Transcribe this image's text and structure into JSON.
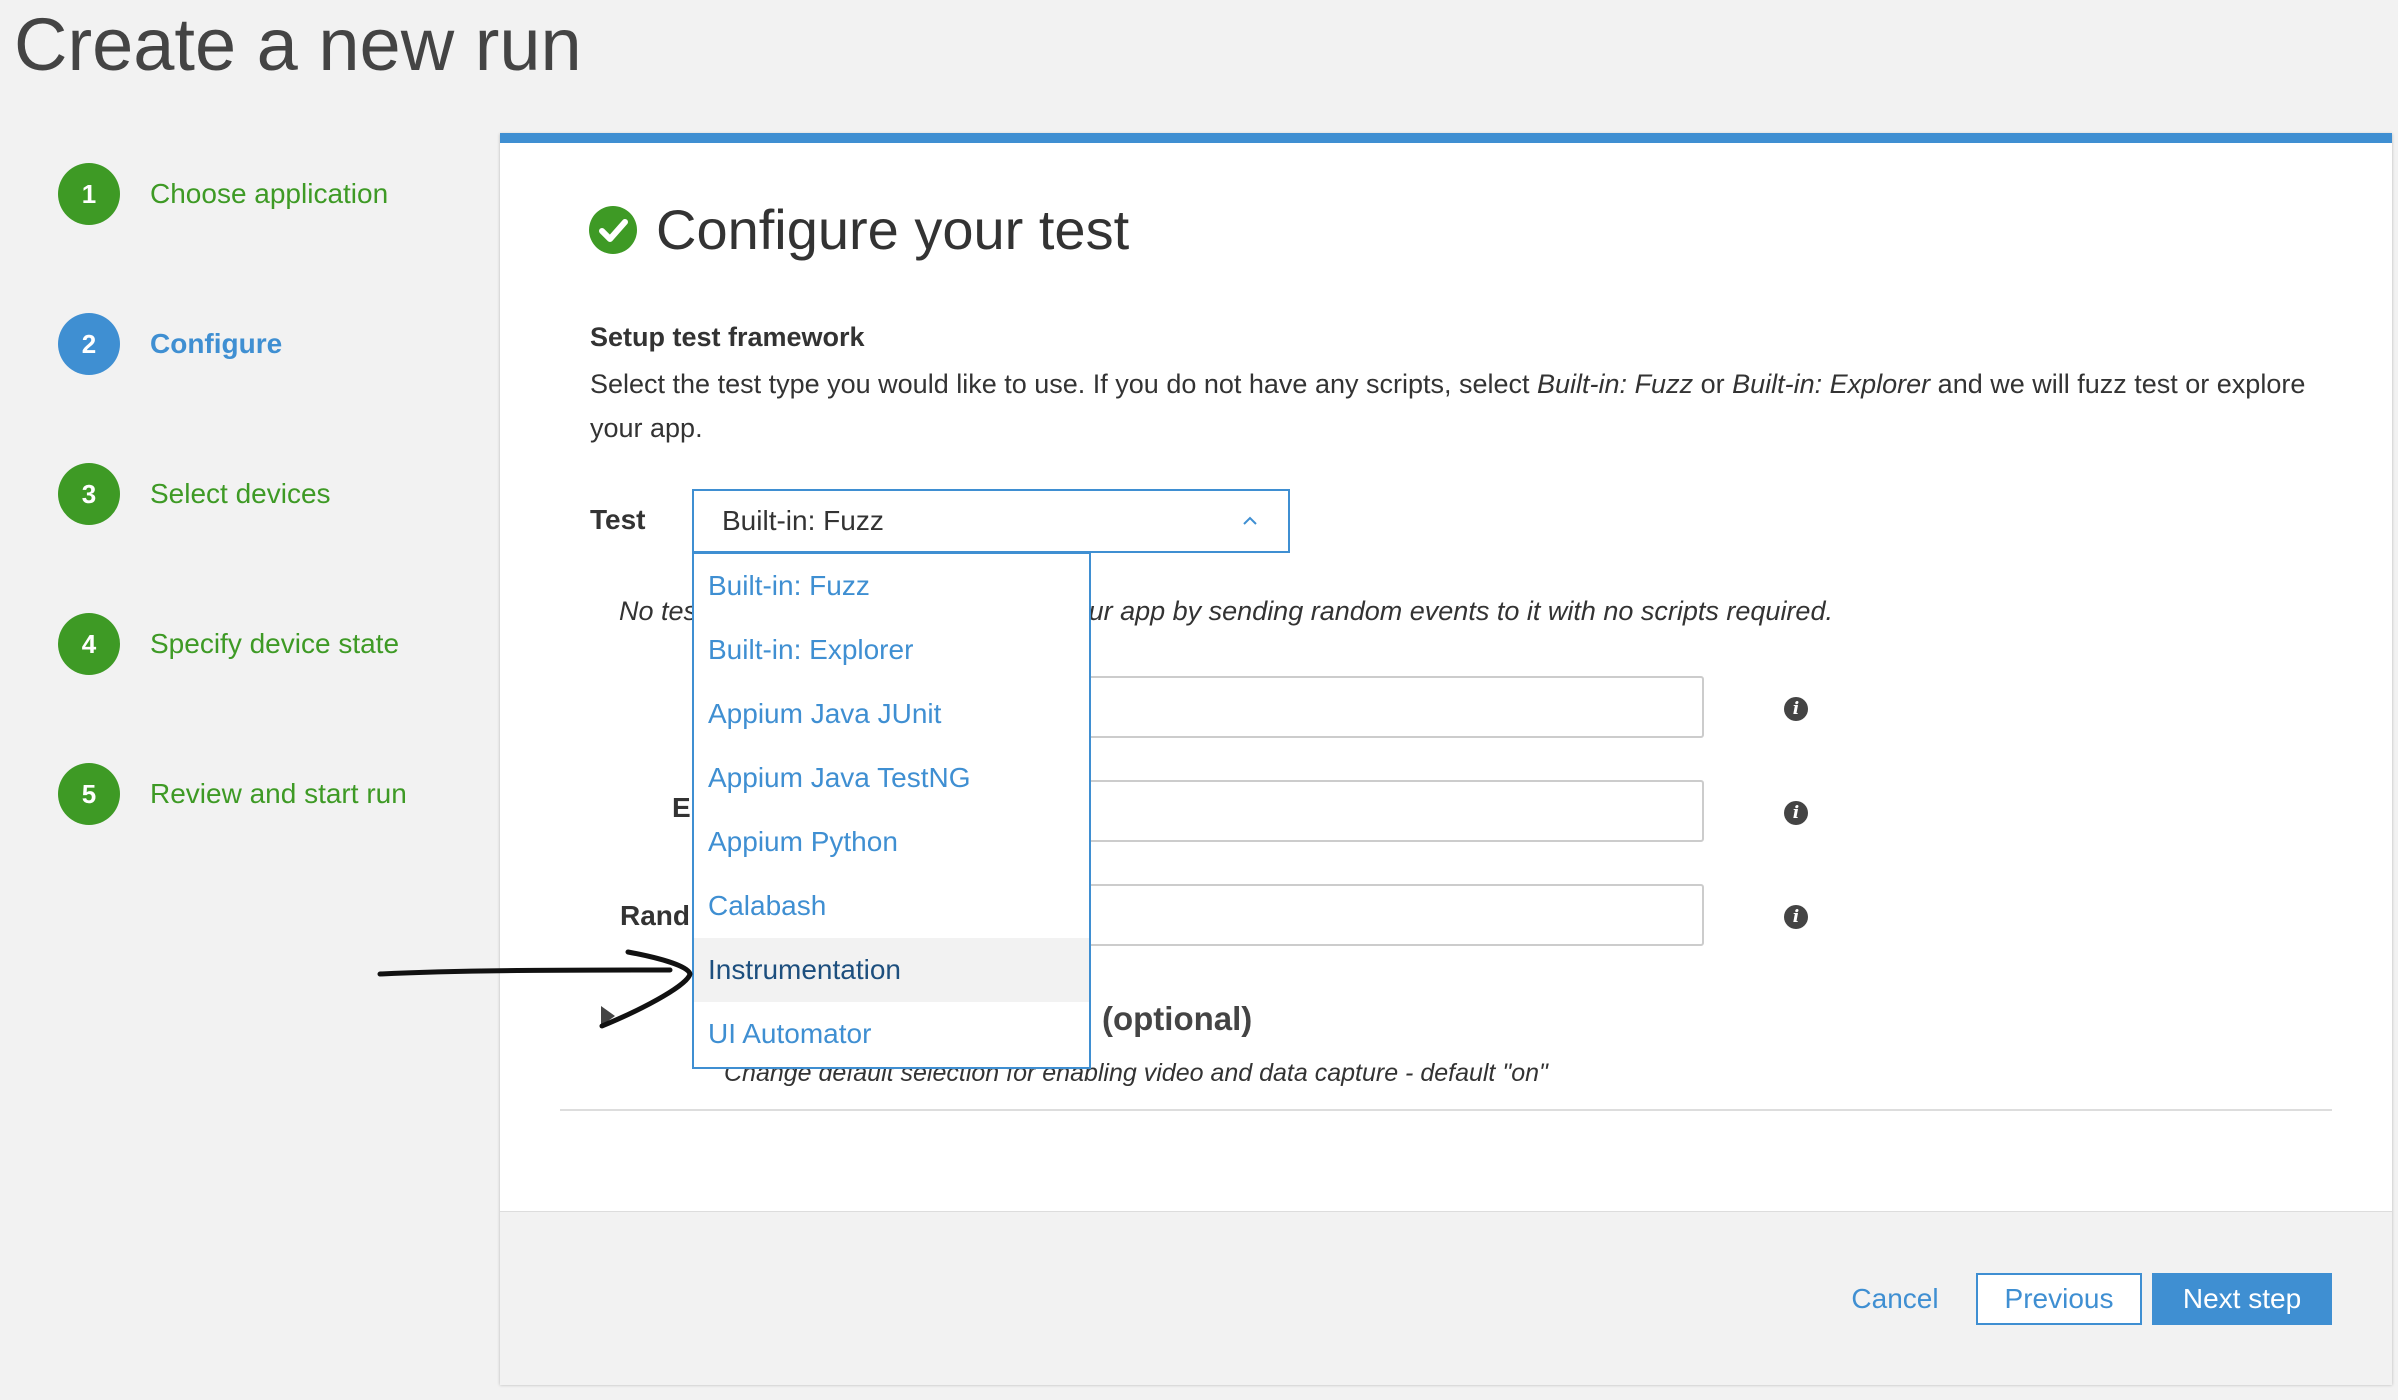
{
  "page": {
    "title": "Create a new run"
  },
  "steps": [
    {
      "number": "1",
      "label": "Choose application",
      "status": "completed"
    },
    {
      "number": "2",
      "label": "Configure",
      "status": "active"
    },
    {
      "number": "3",
      "label": "Select devices",
      "status": "pending"
    },
    {
      "number": "4",
      "label": "Specify device state",
      "status": "pending"
    },
    {
      "number": "5",
      "label": "Review and start run",
      "status": "pending"
    }
  ],
  "configure": {
    "title": "Configure your test",
    "section_label": "Setup test framework",
    "section_desc_1": "Select the test type you would like to use. If you do not have any scripts, select ",
    "section_desc_em1": "Built-in: Fuzz",
    "section_desc_2": " or ",
    "section_desc_em2": "Built-in: Explorer",
    "section_desc_3": " and we will fuzz test or explore your app.",
    "test_label": "Test",
    "test_selected": "Built-in: Fuzz",
    "hint_start": "No tes",
    "hint_end": "your app by sending random events to it with no scripts required.",
    "field_label_2": "E",
    "field_label_3": "Rand",
    "optional_heading": "(optional)",
    "capture_desc": "Change default selection for enabling video and data capture - default \"on\""
  },
  "dropdown": {
    "options": [
      "Built-in: Fuzz",
      "Built-in: Explorer",
      "Appium Java JUnit",
      "Appium Java TestNG",
      "Appium Python",
      "Calabash",
      "Instrumentation",
      "UI Automator"
    ],
    "highlighted": "Instrumentation"
  },
  "footer": {
    "cancel": "Cancel",
    "previous": "Previous",
    "next": "Next step"
  },
  "colors": {
    "accent_blue": "#3f8fd2",
    "success_green": "#3e9a25"
  },
  "icons": {
    "title_status": "check-circle-icon",
    "field_help": "info-icon",
    "select_toggle": "chevron-up-icon"
  }
}
